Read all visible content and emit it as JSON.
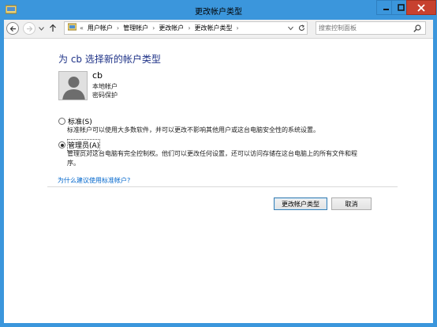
{
  "window": {
    "title": "更改帐户类型"
  },
  "navigation": {
    "breadcrumb_prefix": "«",
    "breadcrumbs": [
      "用户帐户",
      "管理帐户",
      "更改帐户",
      "更改帐户类型"
    ],
    "search_placeholder": "搜索控制面板"
  },
  "page": {
    "title": "为 cb 选择新的帐户类型",
    "user": {
      "name": "cb",
      "type": "本地帐户",
      "protection": "密码保护"
    },
    "options": [
      {
        "label": "标准(S)",
        "description": "标准帐户可以使用大多数软件，并可以更改不影响其他用户或这台电脑安全性的系统设置。",
        "selected": false
      },
      {
        "label": "管理员(A)",
        "description_line1": "管理员对这台电脑有完全控制权。他们可以更改任何设置，还可以访问存储在这台电脑上的所有文件和程",
        "description_line2": "序。",
        "selected": true
      }
    ],
    "help_link": "为什么建议使用标准帐户?",
    "buttons": {
      "change": "更改帐户类型",
      "cancel": "取消"
    }
  }
}
